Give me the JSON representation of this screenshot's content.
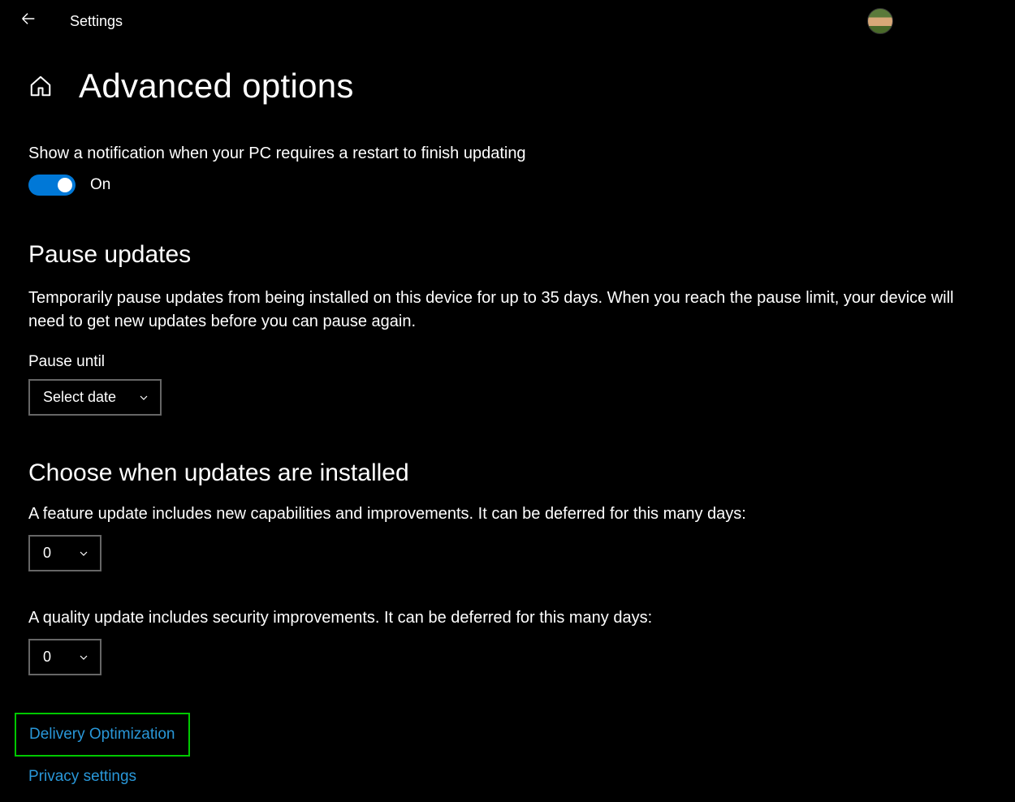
{
  "header": {
    "title": "Settings"
  },
  "page": {
    "title": "Advanced options"
  },
  "notification": {
    "label": "Show a notification when your PC requires a restart to finish updating",
    "state_text": "On",
    "on": true
  },
  "pause": {
    "heading": "Pause updates",
    "desc": "Temporarily pause updates from being installed on this device for up to 35 days. When you reach the pause limit, your device will need to get new updates before you can pause again.",
    "field_label": "Pause until",
    "selected": "Select date"
  },
  "choose": {
    "heading": "Choose when updates are installed",
    "feature_label": "A feature update includes new capabilities and improvements. It can be deferred for this many days:",
    "feature_value": "0",
    "quality_label": "A quality update includes security improvements. It can be deferred for this many days:",
    "quality_value": "0"
  },
  "links": {
    "delivery": "Delivery Optimization",
    "privacy": "Privacy settings"
  }
}
